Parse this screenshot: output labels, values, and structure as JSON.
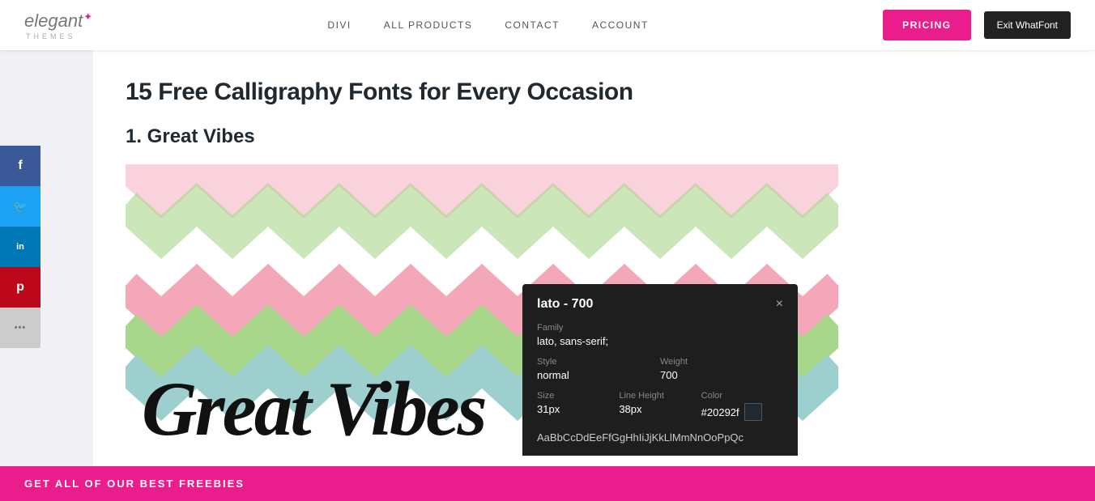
{
  "header": {
    "logo": {
      "elegant": "elegant",
      "star": "✦",
      "themes": "themes"
    },
    "nav": [
      {
        "label": "DIVI",
        "id": "divi"
      },
      {
        "label": "ALL PRODUCTS",
        "id": "all-products"
      },
      {
        "label": "CONTACT",
        "id": "contact"
      },
      {
        "label": "ACCOUNT",
        "id": "account"
      }
    ],
    "pricing_label": "PRICING",
    "exit_whatfont_label": "Exit WhatFont"
  },
  "social": [
    {
      "icon": "f",
      "label": "Facebook",
      "color": "#3b5998"
    },
    {
      "icon": "t",
      "label": "Twitter",
      "color": "#1da1f2"
    },
    {
      "icon": "in",
      "label": "LinkedIn",
      "color": "#0077b5"
    },
    {
      "icon": "p",
      "label": "Pinterest",
      "color": "#bd081c"
    },
    {
      "icon": "•••",
      "label": "More",
      "color": "#ccc"
    }
  ],
  "page": {
    "title": "15 Free Calligraphy Fonts for Every Occasion",
    "section_1": "1. Great Vibes",
    "calligraphy_text": "Great Vibes"
  },
  "whatfont_popup": {
    "title": "lato - 700",
    "close_label": "×",
    "family_label": "Family",
    "family_value": "lato, sans-serif;",
    "style_label": "Style",
    "style_value": "normal",
    "weight_label": "Weight",
    "weight_value": "700",
    "size_label": "Size",
    "size_value": "31px",
    "line_height_label": "Line Height",
    "line_height_value": "38px",
    "color_label": "Color",
    "color_value": "#20292f",
    "swatch_color": "#20292f",
    "alphabet": "AaBbCcDdEeFfGgHhIiJjKkLlMmNnOoPpQc",
    "twitter_icon": "🐦"
  },
  "bottom_bar": {
    "label": "GET ALL OF OUR BEST FREEBIES"
  }
}
